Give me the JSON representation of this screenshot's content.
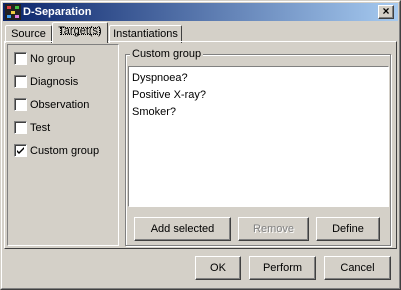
{
  "window": {
    "title": "D-Separation",
    "close_glyph": "×"
  },
  "tabs": [
    "Source",
    "Target(s)",
    "Instantiations"
  ],
  "groups": [
    {
      "label": "No group",
      "checked": false
    },
    {
      "label": "Diagnosis",
      "checked": false
    },
    {
      "label": "Observation",
      "checked": false
    },
    {
      "label": "Test",
      "checked": false
    },
    {
      "label": "Custom group",
      "checked": true
    }
  ],
  "custom_group": {
    "title": "Custom group",
    "items": [
      "Dyspnoea?",
      "Positive X-ray?",
      "Smoker?"
    ],
    "buttons": {
      "add": "Add selected",
      "remove": "Remove",
      "define": "Define"
    }
  },
  "footer": {
    "ok": "OK",
    "perform": "Perform",
    "cancel": "Cancel"
  }
}
